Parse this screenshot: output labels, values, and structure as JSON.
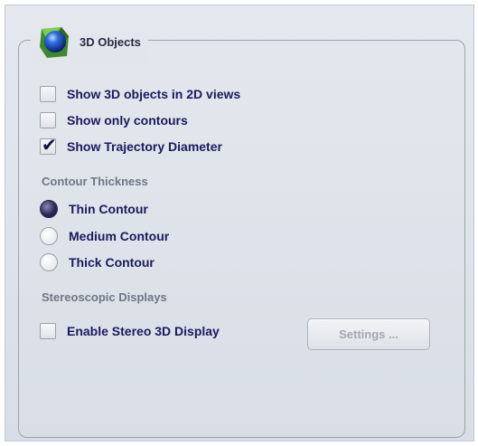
{
  "group": {
    "title": "3D Objects",
    "icon": "blue-sphere-icon"
  },
  "display_options": [
    {
      "label": "Show 3D objects in 2D views",
      "checked": false
    },
    {
      "label": "Show only contours",
      "checked": false
    },
    {
      "label": "Show Trajectory Diameter",
      "checked": true
    }
  ],
  "checkmark_glyph": "✔",
  "contour_thickness": {
    "heading": "Contour Thickness",
    "options": [
      {
        "label": "Thin Contour",
        "selected": true
      },
      {
        "label": "Medium Contour",
        "selected": false
      },
      {
        "label": "Thick Contour",
        "selected": false
      }
    ]
  },
  "stereo": {
    "heading": "Stereoscopic Displays",
    "enable_label": "Enable Stereo 3D Display",
    "enabled": false,
    "settings_label": "Settings ...",
    "settings_disabled": true
  },
  "colors": {
    "label_text": "#1a1a5e",
    "heading_text": "#6e7784",
    "disabled_text": "#a4a9b1",
    "panel_bg": "#e2e6ec"
  }
}
